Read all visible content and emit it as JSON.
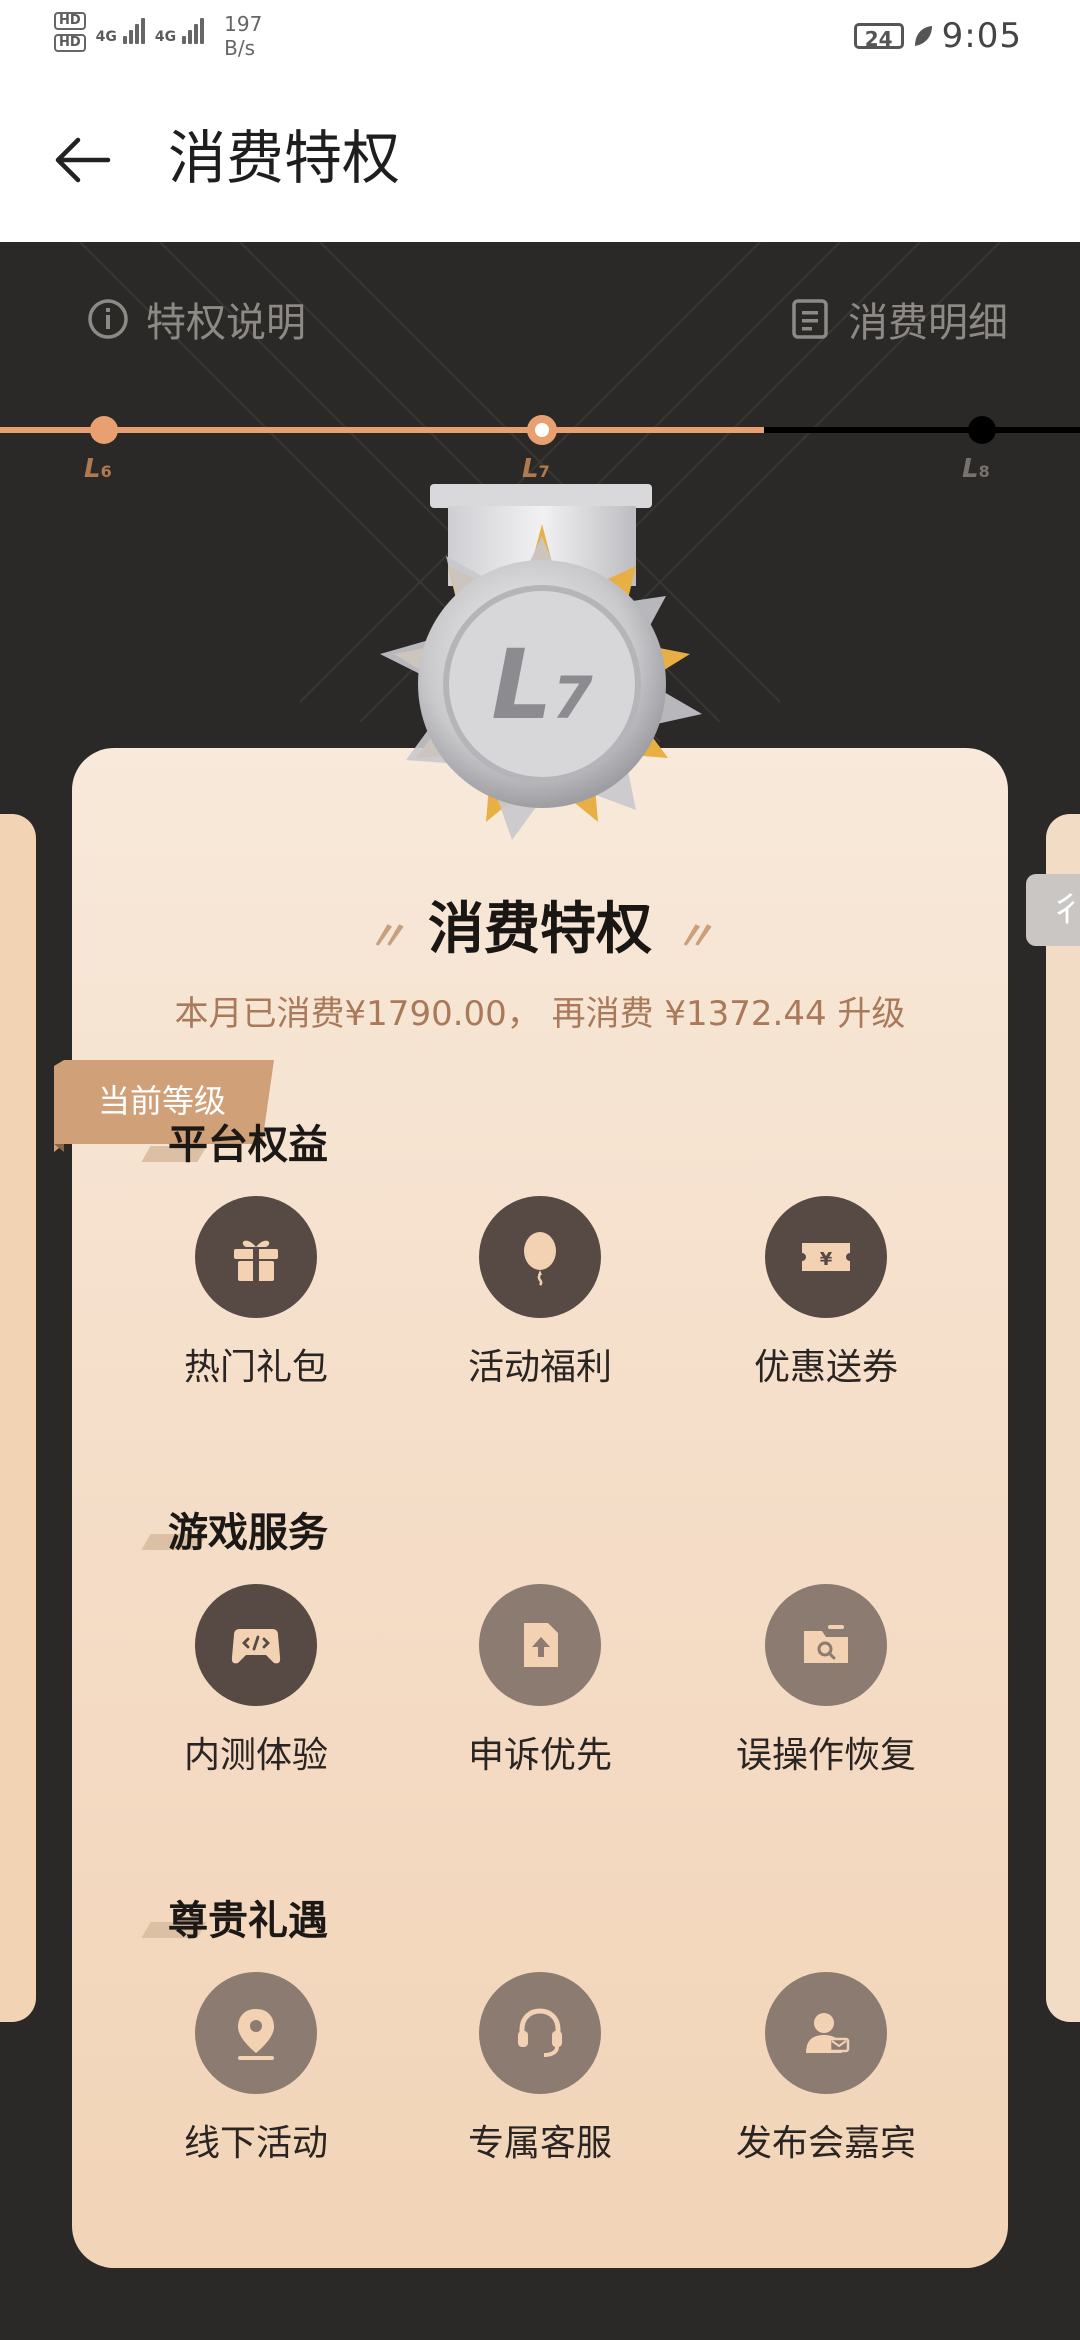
{
  "status_bar": {
    "hd1": "HD",
    "hd2": "HD",
    "net1": "4G",
    "net2": "4G",
    "speed_value": "197",
    "speed_unit": "B/s",
    "battery": "24",
    "time": "9:05"
  },
  "app_bar": {
    "title": "消费特权"
  },
  "top_links": {
    "left": "特权说明",
    "right": "消费明细"
  },
  "levels": [
    {
      "letter": "L",
      "num": "6"
    },
    {
      "letter": "L",
      "num": "7"
    },
    {
      "letter": "L",
      "num": "8"
    }
  ],
  "medal": {
    "letter": "L",
    "num": "7"
  },
  "card": {
    "badge": "当前等级",
    "headline": "消费特权",
    "quote_left": "〃",
    "quote_right": "〃",
    "progress_text": "本月已消费¥1790.00， 再消费 ¥1372.44 升级",
    "side_tab_char": "彳"
  },
  "sections": [
    {
      "title": "平台权益",
      "items": [
        {
          "label": "热门礼包",
          "icon": "gift-icon"
        },
        {
          "label": "活动福利",
          "icon": "balloon-icon"
        },
        {
          "label": "优惠送券",
          "icon": "coupon-icon"
        }
      ]
    },
    {
      "title": "游戏服务",
      "items": [
        {
          "label": "内测体验",
          "icon": "gamepad-code-icon"
        },
        {
          "label": "申诉优先",
          "icon": "appeal-document-icon"
        },
        {
          "label": "误操作恢复",
          "icon": "folder-search-icon"
        }
      ]
    },
    {
      "title": "尊贵礼遇",
      "items": [
        {
          "label": "线下活动",
          "icon": "location-pin-icon"
        },
        {
          "label": "专属客服",
          "icon": "headset-icon"
        },
        {
          "label": "发布会嘉宾",
          "icon": "guest-pass-icon"
        }
      ]
    }
  ],
  "colors": {
    "accent": "#e8a070",
    "card_top": "#f8e9da",
    "card_bottom": "#f2d4b7",
    "dark_bg": "#2b2928",
    "icon_dark": "#574a44",
    "icon_mid": "#8c7b71"
  }
}
